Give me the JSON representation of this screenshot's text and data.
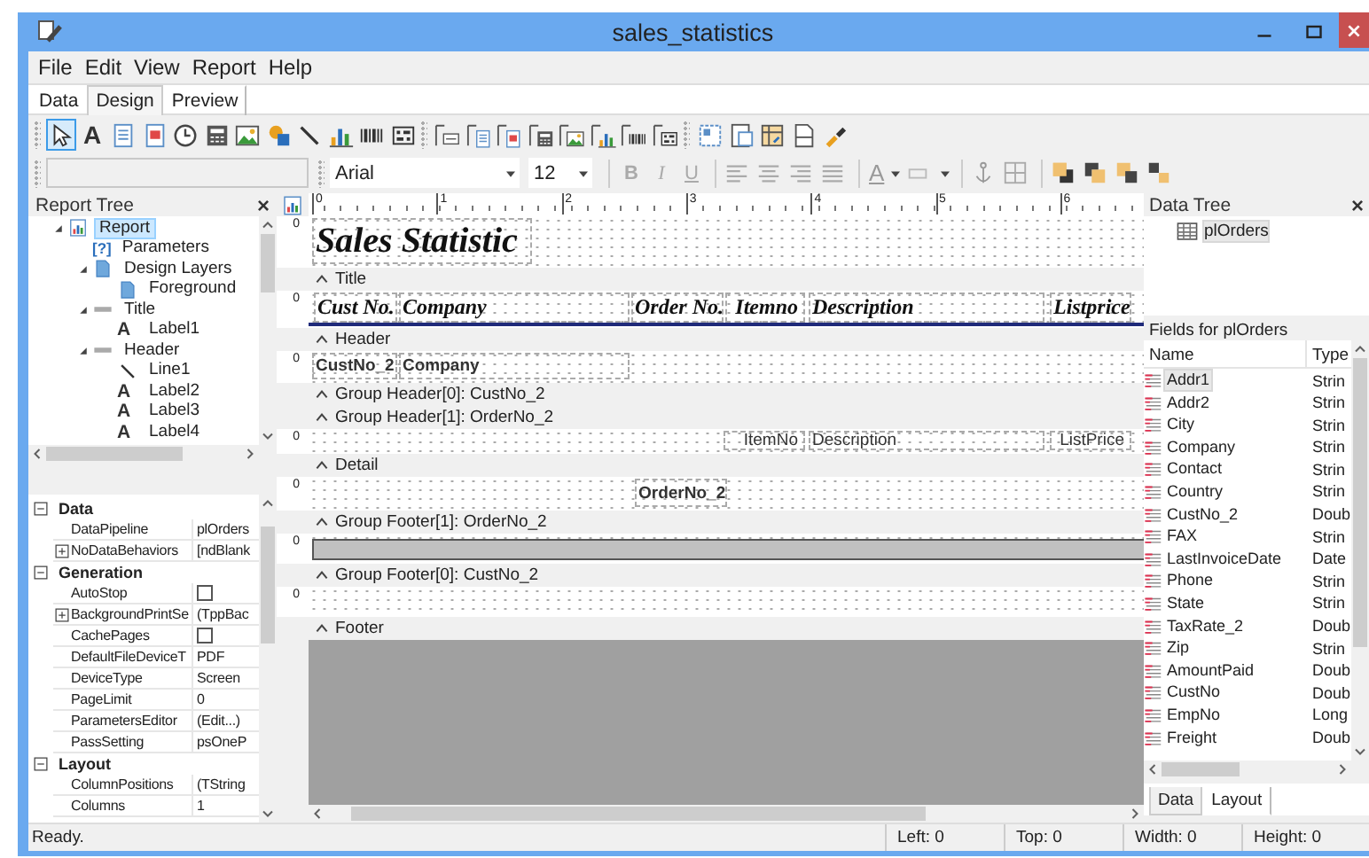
{
  "window": {
    "title": "sales_statistics"
  },
  "menu": [
    "File",
    "Edit",
    "View",
    "Report",
    "Help"
  ],
  "tabs": [
    {
      "label": "Data",
      "selected": false
    },
    {
      "label": "Design",
      "selected": true
    },
    {
      "label": "Preview",
      "selected": false
    }
  ],
  "toolbar": [
    [
      {
        "kind": "pointer",
        "selected": true
      },
      {
        "kind": "label",
        "glyph": "A",
        "selected": false
      },
      {
        "kind": "memo",
        "selected": false
      },
      {
        "kind": "richtext",
        "selected": false
      },
      {
        "kind": "clock",
        "selected": false
      },
      {
        "kind": "calc",
        "selected": false
      },
      {
        "kind": "image",
        "selected": false
      },
      {
        "kind": "shape",
        "selected": false
      },
      {
        "kind": "line",
        "selected": false
      },
      {
        "kind": "chart",
        "selected": false
      },
      {
        "kind": "barcode",
        "selected": false
      },
      {
        "kind": "matrix",
        "selected": false
      }
    ],
    [
      {
        "kind": "db-label",
        "selected": false
      },
      {
        "kind": "db-memo",
        "selected": false
      },
      {
        "kind": "db-richtext",
        "selected": false
      },
      {
        "kind": "db-calc",
        "selected": false
      },
      {
        "kind": "db-image",
        "selected": false
      },
      {
        "kind": "db-chart",
        "selected": false
      },
      {
        "kind": "db-barcode",
        "selected": false
      },
      {
        "kind": "db-matrix",
        "selected": false
      }
    ],
    [
      {
        "kind": "region",
        "selected": false
      },
      {
        "kind": "subreport",
        "selected": false
      },
      {
        "kind": "crosstab",
        "selected": false
      },
      {
        "kind": "page",
        "selected": false
      },
      {
        "kind": "paint",
        "selected": false
      }
    ]
  ],
  "format_bar": {
    "font": "Arial",
    "size": "12",
    "style_buttons": [
      {
        "label": "B",
        "disabled": true
      },
      {
        "label": "I",
        "disabled": true
      },
      {
        "label": "U",
        "disabled": true
      }
    ],
    "color_glyph": "A"
  },
  "report_tree": {
    "title": "Report Tree",
    "close": "×",
    "items": [
      {
        "label": "Report",
        "kind": "report",
        "selected": true,
        "expanded": true,
        "children": [
          {
            "label": "Parameters",
            "kind": "parameters",
            "glyph": "[?]",
            "selected": false
          },
          {
            "label": "Design Layers",
            "kind": "layers",
            "selected": false,
            "expanded": true,
            "children": [
              {
                "label": "Foreground",
                "kind": "layers",
                "selected": false
              }
            ]
          },
          {
            "label": "Title",
            "kind": "band",
            "selected": false,
            "expanded": true,
            "children": [
              {
                "label": "Label1",
                "kind": "label",
                "glyph": "A",
                "selected": false
              }
            ]
          },
          {
            "label": "Header",
            "kind": "band",
            "selected": false,
            "expanded": true,
            "children": [
              {
                "label": "Line1",
                "kind": "line",
                "selected": false
              },
              {
                "label": "Label2",
                "kind": "label",
                "glyph": "A",
                "selected": false
              },
              {
                "label": "Label3",
                "kind": "label",
                "glyph": "A",
                "selected": false
              },
              {
                "label": "Label4",
                "kind": "label",
                "glyph": "A",
                "selected": false
              }
            ]
          }
        ]
      }
    ]
  },
  "properties": [
    {
      "category": "Data",
      "expanded": true,
      "items": [
        {
          "name": "DataPipeline",
          "kind": "text",
          "value": "plOrders"
        },
        {
          "name": "NoDataBehaviors",
          "kind": "text",
          "value": "[ndBlank",
          "expanded": false
        }
      ]
    },
    {
      "category": "Generation",
      "expanded": true,
      "items": [
        {
          "name": "AutoStop",
          "kind": "checkbox",
          "checked": false
        },
        {
          "name": "BackgroundPrintSe",
          "kind": "text",
          "value": "(TppBac",
          "expanded": false
        },
        {
          "name": "CachePages",
          "kind": "checkbox",
          "checked": false
        },
        {
          "name": "DefaultFileDeviceT",
          "kind": "text",
          "value": "PDF"
        },
        {
          "name": "DeviceType",
          "kind": "text",
          "value": "Screen"
        },
        {
          "name": "PageLimit",
          "kind": "text",
          "value": "0"
        },
        {
          "name": "ParametersEditor",
          "kind": "text",
          "value": "(Edit...)"
        },
        {
          "name": "PassSetting",
          "kind": "text",
          "value": "psOneP"
        }
      ]
    },
    {
      "category": "Layout",
      "expanded": true,
      "items": [
        {
          "name": "ColumnPositions",
          "kind": "text",
          "value": "(TString"
        },
        {
          "name": "Columns",
          "kind": "text",
          "value": "1"
        }
      ]
    }
  ],
  "designer": {
    "ruler": [
      "0",
      "1",
      "2",
      "3",
      "4",
      "5",
      "6"
    ],
    "bands": [
      {
        "label": "Title",
        "gutter": "0",
        "items": [
          {
            "kind": "title",
            "text": "Sales Statistic"
          }
        ]
      },
      {
        "label": "Header",
        "gutter": "0",
        "items": [
          {
            "kind": "heading",
            "text": "Cust No."
          },
          {
            "kind": "heading",
            "text": "Company"
          },
          {
            "kind": "heading",
            "text": "Order No."
          },
          {
            "kind": "heading",
            "text": "Itemno"
          },
          {
            "kind": "heading",
            "text": "Description"
          },
          {
            "kind": "heading",
            "text": "Listprice"
          },
          {
            "kind": "line"
          }
        ]
      },
      {
        "label": "Group Header[0]: CustNo_2",
        "gutter": "0",
        "items": [
          {
            "kind": "field",
            "text": "CustNo_2"
          },
          {
            "kind": "field",
            "text": "Company"
          }
        ]
      },
      {
        "label": "Group Header[1]: OrderNo_2"
      },
      {
        "label": "Detail",
        "gutter": "0",
        "items": [
          {
            "kind": "data",
            "text": "ItemNo"
          },
          {
            "kind": "data",
            "text": "Description"
          },
          {
            "kind": "data",
            "text": "ListPrice"
          }
        ]
      },
      {
        "label": "Group Footer[1]: OrderNo_2",
        "gutter": "0",
        "items": [
          {
            "kind": "field",
            "text": "OrderNo_2"
          }
        ]
      },
      {
        "label": "Group Footer[0]: CustNo_2",
        "gutter": "0",
        "items": [
          {
            "kind": "shape"
          }
        ]
      },
      {
        "label": "Footer",
        "gutter": "0"
      }
    ]
  },
  "data_tree": {
    "title": "Data Tree",
    "close": "×",
    "tables": [
      {
        "name": "plOrders",
        "selected": true
      }
    ],
    "fields_title": "Fields for plOrders",
    "columns": [
      "Name",
      "Type"
    ],
    "fields": [
      {
        "name": "Addr1",
        "type": "Strin",
        "selected": true
      },
      {
        "name": "Addr2",
        "type": "Strin",
        "selected": false
      },
      {
        "name": "City",
        "type": "Strin",
        "selected": false
      },
      {
        "name": "Company",
        "type": "Strin",
        "selected": false
      },
      {
        "name": "Contact",
        "type": "Strin",
        "selected": false
      },
      {
        "name": "Country",
        "type": "Strin",
        "selected": false
      },
      {
        "name": "CustNo_2",
        "type": "Doub",
        "selected": false
      },
      {
        "name": "FAX",
        "type": "Strin",
        "selected": false
      },
      {
        "name": "LastInvoiceDate",
        "type": "Date",
        "selected": false
      },
      {
        "name": "Phone",
        "type": "Strin",
        "selected": false
      },
      {
        "name": "State",
        "type": "Strin",
        "selected": false
      },
      {
        "name": "TaxRate_2",
        "type": "Doub",
        "selected": false
      },
      {
        "name": "Zip",
        "type": "Strin",
        "selected": false
      },
      {
        "name": "AmountPaid",
        "type": "Doub",
        "selected": false
      },
      {
        "name": "CustNo",
        "type": "Doub",
        "selected": false
      },
      {
        "name": "EmpNo",
        "type": "Long",
        "selected": false
      },
      {
        "name": "Freight",
        "type": "Doub",
        "selected": false
      }
    ],
    "tabs": [
      {
        "label": "Data",
        "selected": true
      },
      {
        "label": "Layout",
        "selected": false
      }
    ]
  },
  "status_bar": {
    "message": "Ready.",
    "panels": [
      "Left: 0",
      "Top: 0",
      "Width: 0",
      "Height: 0"
    ]
  }
}
